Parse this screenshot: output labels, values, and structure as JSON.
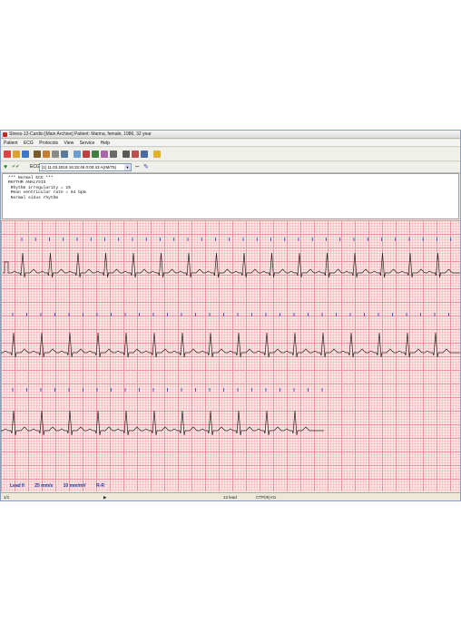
{
  "window": {
    "title": "Stress-12-Cardio [Main Archive]  Patient: Marina, female, 1986, 32 year"
  },
  "menu": [
    "Patient",
    "ECG",
    "Protocols",
    "View",
    "Service",
    "Help"
  ],
  "toolbar": {
    "ecg_label": "ECG:",
    "ecg_selected": "[1] 11.03.2018 16:32:46 0:00:43 A(rM/75)"
  },
  "report": {
    "lines": [
      "*** Normal ECG ***",
      "RHYTHM ANALYSIS",
      " Rhythm irregularity = 1%",
      " Mean ventricular rate = 64 bpm",
      " Normal sinus rhythm"
    ]
  },
  "footer": {
    "lead": "Lead II",
    "speed": "25 mm/s",
    "gain": "10 mm/mV",
    "mode": "R-R"
  },
  "status": {
    "page": "1/1",
    "leads": "12 lead",
    "device": "CTP(III)-01"
  },
  "colors": {
    "grid_major": "#e68c96",
    "grid_minor": "#f5bec3",
    "paper": "#ffe8e8",
    "trace": "#222222",
    "marker": "#2a3ab8",
    "text_blue": "#1a3aa8"
  },
  "icons": [
    "new-icon",
    "open-icon",
    "save-icon",
    "filter-icon",
    "zoom-icon",
    "print-icon",
    "calc-icon",
    "ruler-icon",
    "measure-icon",
    "settings-icon",
    "help-icon",
    "heart-icon",
    "check-icon",
    "pen-icon"
  ]
}
